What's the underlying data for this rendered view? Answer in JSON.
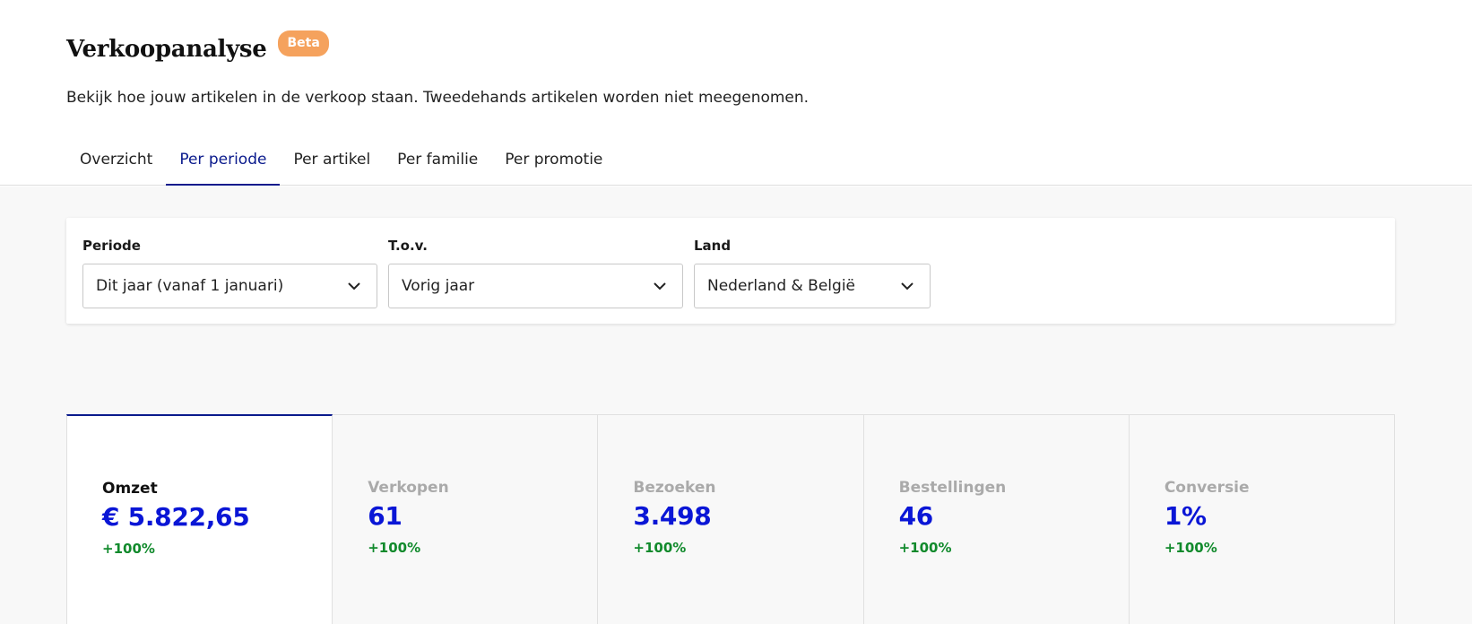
{
  "header": {
    "title": "Verkoopanalyse",
    "badge": "Beta",
    "subtitle": "Bekijk hoe jouw artikelen in de verkoop staan. Tweedehands artikelen worden niet meegenomen."
  },
  "tabs": [
    {
      "label": "Overzicht",
      "active": false
    },
    {
      "label": "Per periode",
      "active": true
    },
    {
      "label": "Per artikel",
      "active": false
    },
    {
      "label": "Per familie",
      "active": false
    },
    {
      "label": "Per promotie",
      "active": false
    }
  ],
  "filters": {
    "periode": {
      "label": "Periode",
      "value": "Dit jaar (vanaf 1 januari)"
    },
    "tov": {
      "label": "T.o.v.",
      "value": "Vorig jaar"
    },
    "land": {
      "label": "Land",
      "value": "Nederland & België"
    }
  },
  "kpis": [
    {
      "label": "Omzet",
      "value": "€ 5.822,65",
      "change": "+100%",
      "active": true
    },
    {
      "label": "Verkopen",
      "value": "61",
      "change": "+100%",
      "active": false
    },
    {
      "label": "Bezoeken",
      "value": "3.498",
      "change": "+100%",
      "active": false
    },
    {
      "label": "Bestellingen",
      "value": "46",
      "change": "+100%",
      "active": false
    },
    {
      "label": "Conversie",
      "value": "1%",
      "change": "+100%",
      "active": false
    }
  ],
  "colors": {
    "accent": "#0a1a8c",
    "value": "#0a16d6",
    "positive": "#118a2c",
    "badge": "#f5a25d"
  }
}
